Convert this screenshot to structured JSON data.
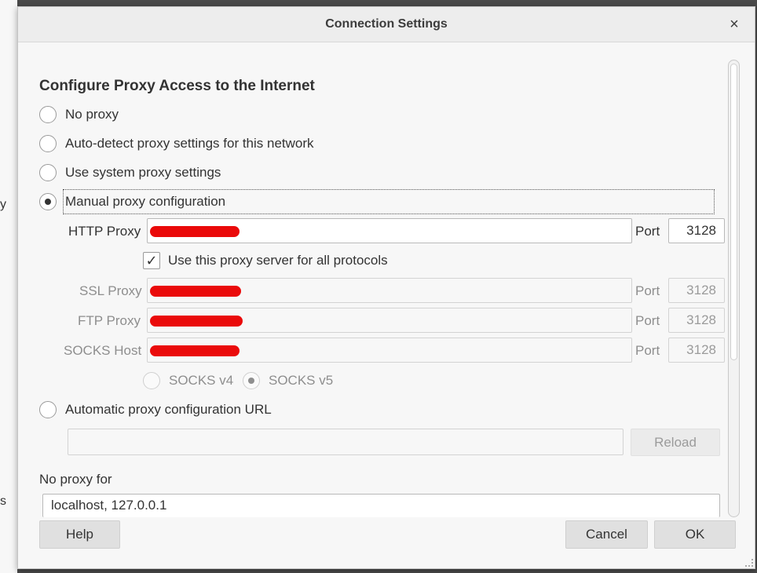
{
  "background": {
    "glyph_top": "y",
    "glyph_bottom": "s"
  },
  "window": {
    "title": "Connection Settings",
    "close_icon": "×"
  },
  "section": {
    "heading": "Configure Proxy Access to the Internet"
  },
  "proxy_options": {
    "no_proxy": "No proxy",
    "auto_detect": "Auto-detect proxy settings for this network",
    "system": "Use system proxy settings",
    "manual": "Manual proxy configuration",
    "auto_url": "Automatic proxy configuration URL",
    "selected": "manual"
  },
  "manual": {
    "http_label": "HTTP Proxy",
    "port_label": "Port",
    "http_port": "3128",
    "use_for_all_label": "Use this proxy server for all protocols",
    "use_for_all_checked": true,
    "check_glyph": "✓",
    "ssl_label": "SSL Proxy",
    "ssl_port": "3128",
    "ftp_label": "FTP Proxy",
    "ftp_port": "3128",
    "socks_label": "SOCKS Host",
    "socks_port": "3128",
    "socks_v4": "SOCKS v4",
    "socks_v5": "SOCKS v5",
    "socks_selected": "v5"
  },
  "auto_url": {
    "value": "",
    "reload_label": "Reload"
  },
  "no_proxy_for": {
    "label": "No proxy for",
    "value": "localhost, 127.0.0.1"
  },
  "buttons": {
    "help": "Help",
    "cancel": "Cancel",
    "ok": "OK"
  },
  "colors": {
    "redaction": "#ea0a0a",
    "background": "#f7f7f7"
  }
}
